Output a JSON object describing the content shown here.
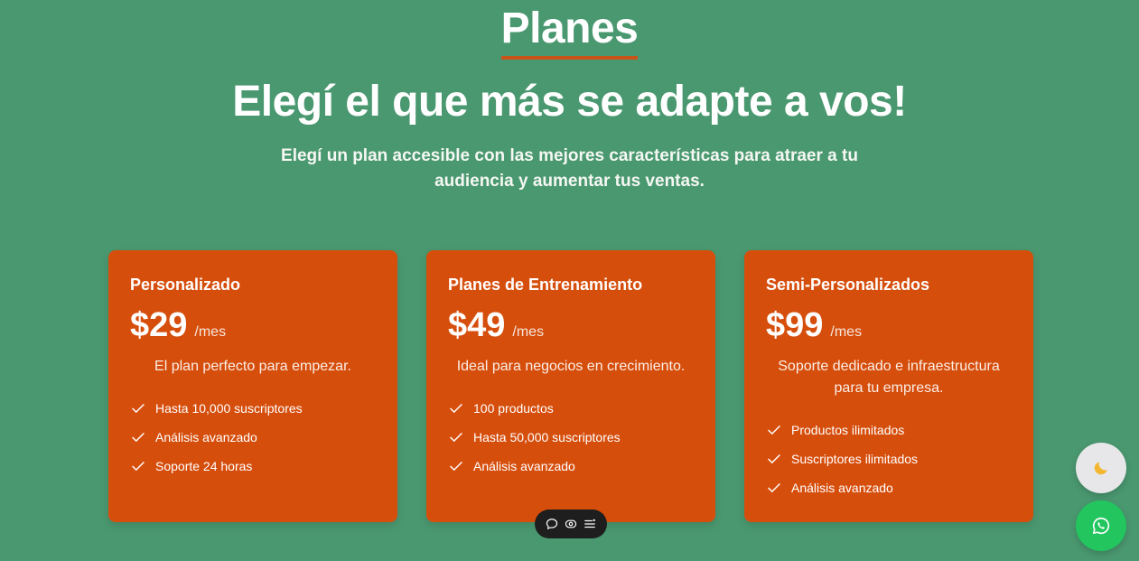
{
  "section": {
    "title": "Planes",
    "headline": "Elegí el que más se adapte a vos!",
    "subtitle": "Elegí un plan accesible con las mejores características para atraer a tu audiencia y aumentar tus ventas."
  },
  "plans": [
    {
      "name": "Personalizado",
      "price": "$29",
      "period": "/mes",
      "description": "El plan perfecto para empezar.",
      "features": [
        "Hasta 10,000 suscriptores",
        "Análisis avanzado",
        "Soporte 24 horas"
      ]
    },
    {
      "name": "Planes de Entrenamiento",
      "price": "$49",
      "period": "/mes",
      "description": "Ideal para negocios en crecimiento.",
      "features": [
        "100 productos",
        "Hasta 50,000 suscriptores",
        "Análisis avanzado"
      ]
    },
    {
      "name": "Semi-Personalizados",
      "price": "$99",
      "period": "/mes",
      "description": "Soporte dedicado e infraestructura para tu empresa.",
      "features": [
        "Productos ilimitados",
        "Suscriptores ilimitados",
        "Análisis avanzado"
      ]
    }
  ],
  "floating_buttons": {
    "theme_icon": "moon-icon",
    "chat_icon": "whatsapp-icon"
  },
  "toolbar": {
    "icons": [
      "comment-icon",
      "eye-icon",
      "menu-icon"
    ]
  },
  "colors": {
    "background": "#4a9870",
    "card": "#d64e0c",
    "title_underline": "#c8541a",
    "whatsapp": "#22c55e"
  }
}
